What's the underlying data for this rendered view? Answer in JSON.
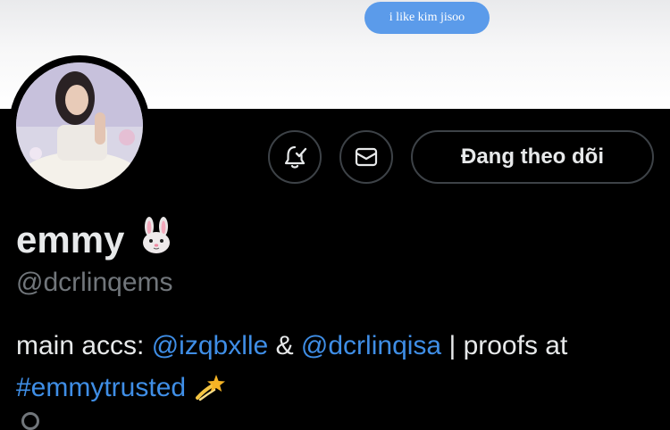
{
  "message_bubble": {
    "text": "i like kim jisoo"
  },
  "profile": {
    "display_name": "emmy",
    "name_emoji": "rabbit-face-icon",
    "handle": "@dcrlinqems",
    "bio": {
      "part1": "main accs: ",
      "mention1": "@izqbxlle",
      "part2": " & ",
      "mention2": "@dcrlinqisa",
      "part3": " | proofs at",
      "hashtag": "#emmytrusted",
      "trailing_emoji": "dizzy-icon"
    }
  },
  "actions": {
    "notify_icon": "bell-check-icon",
    "message_icon": "envelope-icon",
    "follow_label": "Đang theo dõi"
  },
  "colors": {
    "background": "#000000",
    "bubble": "#5b9bea",
    "link": "#3f8ee6",
    "muted": "#71767b",
    "border": "#3d4247"
  }
}
